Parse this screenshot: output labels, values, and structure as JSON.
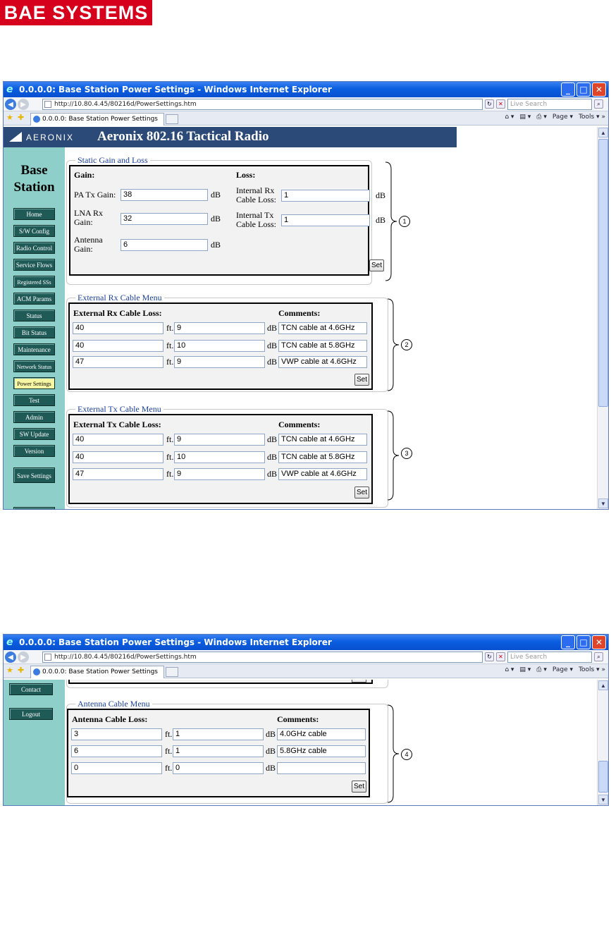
{
  "brand_logo": "BAE SYSTEMS",
  "window": {
    "title": "0.0.0.0: Base Station Power Settings - Windows Internet Explorer",
    "url": "http://10.80.4.45/80216d/PowerSettings.htm",
    "tab_label": "0.0.0.0: Base Station Power Settings",
    "search_placeholder": "Live Search",
    "cmd_page": "Page",
    "cmd_tools": "Tools"
  },
  "header": {
    "logo_text": "AERONIX",
    "title": "Aeronix 802.16 Tactical Radio"
  },
  "sidebar": {
    "title_line1": "Base",
    "title_line2": "Station",
    "items": [
      {
        "label": "Home"
      },
      {
        "label": "S/W Config"
      },
      {
        "label": "Radio Control"
      },
      {
        "label": "Service Flows"
      },
      {
        "label": "Registered SSs"
      },
      {
        "label": "ACM Params"
      },
      {
        "label": "Status"
      },
      {
        "label": "Bit Status"
      },
      {
        "label": "Maintenance"
      },
      {
        "label": "Network Status"
      },
      {
        "label": "Power Settings",
        "active": true
      },
      {
        "label": "Test"
      },
      {
        "label": "Admin"
      },
      {
        "label": "SW Update"
      },
      {
        "label": "Version"
      }
    ],
    "save_settings": "Save Settings",
    "contact": "Contact",
    "logout": "Logout"
  },
  "static_gain": {
    "legend": "Static Gain and Loss",
    "gain_header": "Gain:",
    "loss_header": "Loss:",
    "pa_tx_label": "PA Tx Gain:",
    "pa_tx_value": "38",
    "lna_rx_label_1": "LNA Rx",
    "lna_rx_label_2": "Gain:",
    "lna_rx_value": "32",
    "antenna_label_1": "Antenna",
    "antenna_label_2": "Gain:",
    "antenna_value": "6",
    "int_rx_label_1": "Internal Rx",
    "int_rx_label_2": "Cable Loss:",
    "int_rx_value": "1",
    "int_tx_label_1": "Internal Tx",
    "int_tx_label_2": "Cable Loss:",
    "int_tx_value": "1",
    "unit": "dB",
    "set": "Set"
  },
  "ext_rx": {
    "legend": "External Rx Cable Menu",
    "header": "External Rx Cable Loss:",
    "comments_header": "Comments:",
    "rows": [
      {
        "length": "40",
        "loss": "9",
        "comment": "TCN cable at 4.6GHz"
      },
      {
        "length": "40",
        "loss": "10",
        "comment": "TCN cable at 5.8GHz"
      },
      {
        "length": "47",
        "loss": "9",
        "comment": "VWP cable at 4.6GHz"
      }
    ],
    "set": "Set"
  },
  "ext_tx": {
    "legend": "External Tx Cable Menu",
    "header": "External Tx Cable Loss:",
    "comments_header": "Comments:",
    "rows": [
      {
        "length": "40",
        "loss": "9",
        "comment": "TCN cable at 4.6GHz"
      },
      {
        "length": "40",
        "loss": "10",
        "comment": "TCN cable at 5.8GHz"
      },
      {
        "length": "47",
        "loss": "9",
        "comment": "VWP cable at 4.6GHz"
      }
    ],
    "set": "Set"
  },
  "antenna": {
    "legend": "Antenna Cable Menu",
    "header": "Antenna Cable Loss:",
    "comments_header": "Comments:",
    "rows": [
      {
        "length": "3",
        "loss": "1",
        "comment": "4.0GHz cable"
      },
      {
        "length": "6",
        "loss": "1",
        "comment": "5.8GHz cable"
      },
      {
        "length": "0",
        "loss": "0",
        "comment": ""
      }
    ],
    "set": "Set"
  },
  "units": {
    "ft": "ft.",
    "db": "dB"
  },
  "callouts": [
    "1",
    "2",
    "3",
    "4"
  ],
  "colors": {
    "title_bar": "#0a5ee0",
    "header_bg": "#2b4a77",
    "sidebar_bg": "#8ecfc9",
    "nav_btn": "#1f5a57",
    "active_nav": "#f7f7a3",
    "legend_text": "#1a3e9c",
    "brand_red": "#d6001c"
  }
}
